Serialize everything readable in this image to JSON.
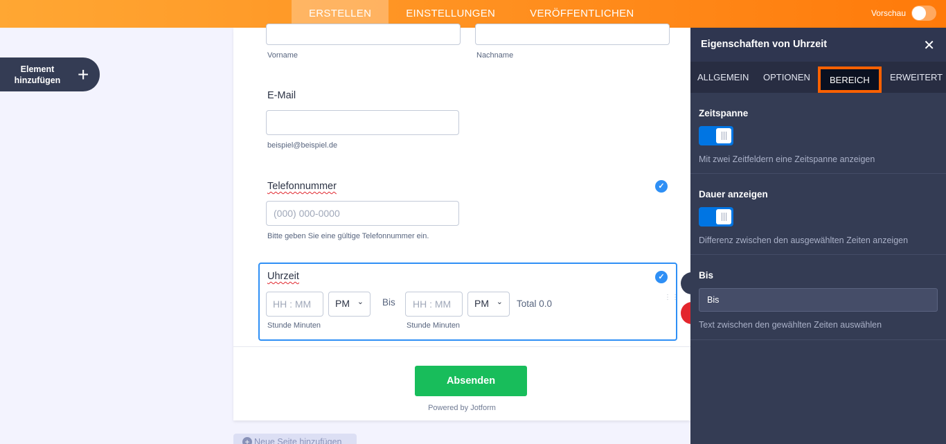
{
  "topbar": {
    "tabs": [
      {
        "label": "ERSTELLEN",
        "active": true
      },
      {
        "label": "EINSTELLUNGEN",
        "active": false
      },
      {
        "label": "VERÖFFENTLICHEN",
        "active": false
      }
    ],
    "preview_label": "Vorschau",
    "preview_on": false
  },
  "add_element": {
    "label": "Element hinzufügen",
    "icon": "plus-icon"
  },
  "form": {
    "name_fields": {
      "first_sublabel": "Vorname",
      "last_sublabel": "Nachname"
    },
    "email": {
      "label": "E-Mail",
      "value": "",
      "sublabel": "beispiel@beispiel.de"
    },
    "phone": {
      "label": "Telefonnummer",
      "placeholder": "(000) 000-0000",
      "sublabel": "Bitte geben Sie eine gültige Telefonnummer ein."
    },
    "time": {
      "label": "Uhrzeit",
      "from": {
        "placeholder": "HH : MM",
        "ampm": "PM",
        "sublabel": "Stunde Minuten"
      },
      "to_label": "Bis",
      "to": {
        "placeholder": "HH : MM",
        "ampm": "PM",
        "sublabel": "Stunde Minuten"
      },
      "total": "Total 0.0"
    },
    "submit_label": "Absenden",
    "powered_by": "Powered by Jotform"
  },
  "new_page": {
    "label": "Neue Seite hinzufügen"
  },
  "panel": {
    "title": "Eigenschaften von Uhrzeit",
    "close_icon": "close-icon",
    "tabs": [
      {
        "label": "ALLGEMEIN",
        "active": false
      },
      {
        "label": "OPTIONEN",
        "active": false
      },
      {
        "label": "BEREICH",
        "active": true
      },
      {
        "label": "ERWEITERT",
        "active": false
      }
    ],
    "time_range": {
      "title": "Zeitspanne",
      "enabled": true,
      "description": "Mit zwei Zeitfeldern eine Zeitspanne anzeigen"
    },
    "show_duration": {
      "title": "Dauer anzeigen",
      "enabled": true,
      "description": "Differenz zwischen den ausgewählten Zeiten anzeigen"
    },
    "until": {
      "title": "Bis",
      "value": "Bis",
      "description": "Text zwischen den gewählten Zeiten auswählen"
    }
  },
  "colors": {
    "accent_orange": "#ff8f1f",
    "panel_bg": "#343c54",
    "active_tab_border": "#ff6100",
    "toggle_on": "#0075e3",
    "submit_green": "#18bd5b",
    "selection_blue": "#2e8ff5"
  }
}
